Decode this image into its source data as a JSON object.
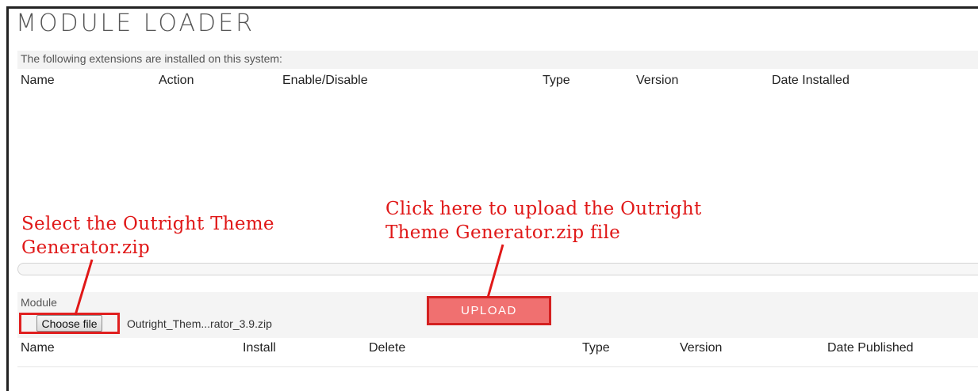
{
  "page": {
    "title": "MODULE LOADER",
    "installed_caption": "The following extensions are installed on this system:"
  },
  "installed_table": {
    "headers": [
      "Name",
      "Action",
      "Enable/Disable",
      "Type",
      "Version",
      "Date Installed"
    ]
  },
  "upload_form": {
    "module_label": "Module",
    "choose_file_label": "Choose file",
    "selected_file": "Outright_Them...rator_3.9.zip",
    "upload_label": "UPLOAD"
  },
  "available_table": {
    "headers": [
      "Name",
      "Install",
      "Delete",
      "Type",
      "Version",
      "Date Published"
    ]
  },
  "annotations": {
    "select_note_line1": "Select the Outright Theme",
    "select_note_line2": "Generator.zip",
    "upload_note_line1": "Click here to upload the Outright",
    "upload_note_line2": "Theme Generator.zip file"
  },
  "colors": {
    "annotation": "#e01818",
    "upload_button": "#f07070"
  }
}
